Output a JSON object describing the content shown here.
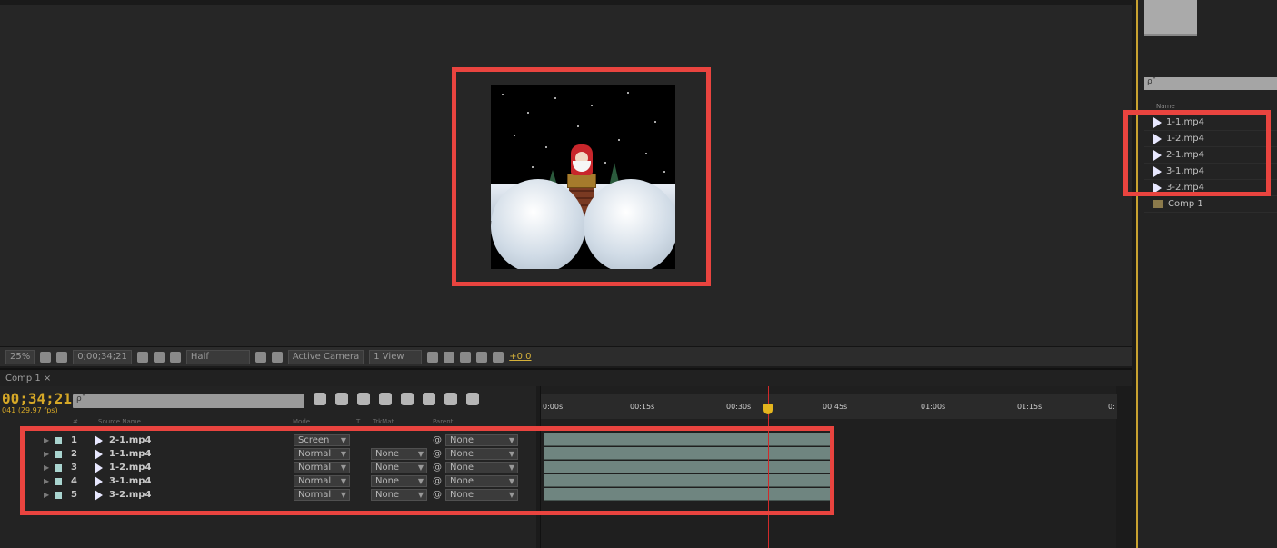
{
  "viewer": {
    "zoom": "25%",
    "timecode": "0;00;34;21",
    "resolution": "Half",
    "camera": "Active Camera",
    "view_layout": "1 View",
    "exposure": "+0.0"
  },
  "timeline": {
    "tab_label": "Comp 1 ×",
    "current_time": "00;34;21",
    "frame_info": "041 (29.97 fps)",
    "search_placeholder": "ρˇ",
    "columns": {
      "num": "#",
      "source_name": "Source Name",
      "mode": "Mode",
      "t": "T",
      "trkmat": "TrkMat",
      "parent": "Parent"
    },
    "ruler_labels": [
      "0:00s",
      "00:15s",
      "00:30s",
      "00:45s",
      "01:00s",
      "01:15s",
      "0:"
    ],
    "layers": [
      {
        "num": "1",
        "name": "2-1.mp4",
        "mode": "Screen",
        "trkmat": "",
        "parent": "None"
      },
      {
        "num": "2",
        "name": "1-1.mp4",
        "mode": "Normal",
        "trkmat": "None",
        "parent": "None"
      },
      {
        "num": "3",
        "name": "1-2.mp4",
        "mode": "Normal",
        "trkmat": "None",
        "parent": "None"
      },
      {
        "num": "4",
        "name": "3-1.mp4",
        "mode": "Normal",
        "trkmat": "None",
        "parent": "None"
      },
      {
        "num": "5",
        "name": "3-2.mp4",
        "mode": "Normal",
        "trkmat": "None",
        "parent": "None"
      }
    ]
  },
  "project": {
    "search_placeholder": "ρˇ",
    "name_header": "Name",
    "items": [
      "1-1.mp4",
      "1-2.mp4",
      "2-1.mp4",
      "3-1.mp4",
      "3-2.mp4"
    ],
    "comp_item": "Comp 1"
  },
  "colors": {
    "highlight_box": "#e9443f",
    "timecode": "#d6a827",
    "label_aqua": "#a9d4cf",
    "layer_bar": "#6f8580"
  }
}
